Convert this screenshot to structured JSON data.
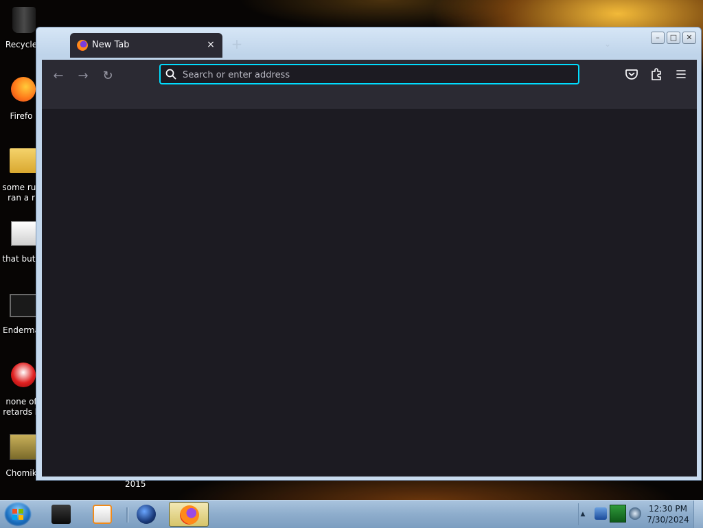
{
  "desktop": {
    "icons": [
      {
        "label": "Recycle"
      },
      {
        "label": "Firefo"
      },
      {
        "label": "some rus ran a r"
      },
      {
        "label": "that but i"
      },
      {
        "label": "Enderma"
      },
      {
        "label": "none of retards k"
      },
      {
        "label": "Chomik"
      }
    ],
    "extra_label": "2015"
  },
  "browser": {
    "tab": {
      "title": "New Tab",
      "close_glyph": "×"
    },
    "new_tab_glyph": "+",
    "tab_list_glyph": "⌄",
    "urlbar": {
      "placeholder": "Search or enter address",
      "value": ""
    },
    "nav": {
      "back_glyph": "←",
      "forward_glyph": "→",
      "reload_glyph": "↻"
    },
    "caption": {
      "minimize": "–",
      "maximize": "□",
      "close": "✕"
    },
    "colors": {
      "toolbar": "#2b2a33",
      "content": "#1c1b22",
      "focus_ring": "#00ddff"
    }
  },
  "taskbar": {
    "clock": {
      "time": "12:30 PM",
      "date": "7/30/2024"
    },
    "tray_up_glyph": "▲"
  }
}
